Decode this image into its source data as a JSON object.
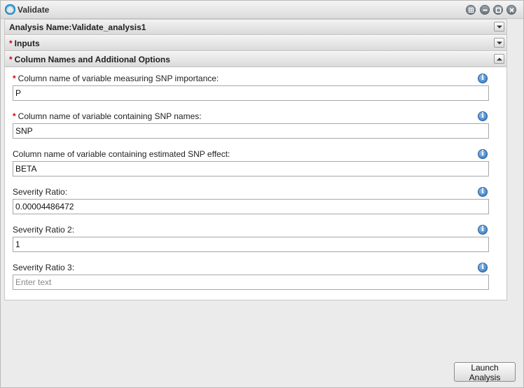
{
  "window": {
    "title": "Validate",
    "icon": "app-logo-icon",
    "controls": [
      "grid-icon",
      "minimize-icon",
      "maximize-icon",
      "close-icon"
    ]
  },
  "sections": {
    "analysis_name": {
      "label": "Analysis Name:Validate_analysis1",
      "toggle_icon": "chevron-down-icon"
    },
    "inputs": {
      "required_mark": "*",
      "label": "Inputs",
      "toggle_icon": "chevron-down-icon"
    },
    "column_names": {
      "required_mark": "*",
      "label": "Column Names and Additional Options",
      "toggle_icon": "chevron-up-icon"
    }
  },
  "fields": [
    {
      "required_mark": "*",
      "label": "Column name of variable measuring SNP importance:",
      "value": "P",
      "placeholder": ""
    },
    {
      "required_mark": "*",
      "label": "Column name of variable containing SNP names:",
      "value": "SNP",
      "placeholder": ""
    },
    {
      "required_mark": "",
      "label": "Column name of variable containing estimated SNP effect:",
      "value": "BETA",
      "placeholder": ""
    },
    {
      "required_mark": "",
      "label": "Severity Ratio:",
      "value": "0.00004486472",
      "placeholder": ""
    },
    {
      "required_mark": "",
      "label": "Severity Ratio 2:",
      "value": "1",
      "placeholder": ""
    },
    {
      "required_mark": "",
      "label": "Severity Ratio 3:",
      "value": "",
      "placeholder": "Enter text"
    }
  ],
  "info_glyph": "i",
  "footer": {
    "launch_label": "Launch Analysis"
  },
  "colors": {
    "required": "#d0021b",
    "info": "#2a6fb9"
  }
}
